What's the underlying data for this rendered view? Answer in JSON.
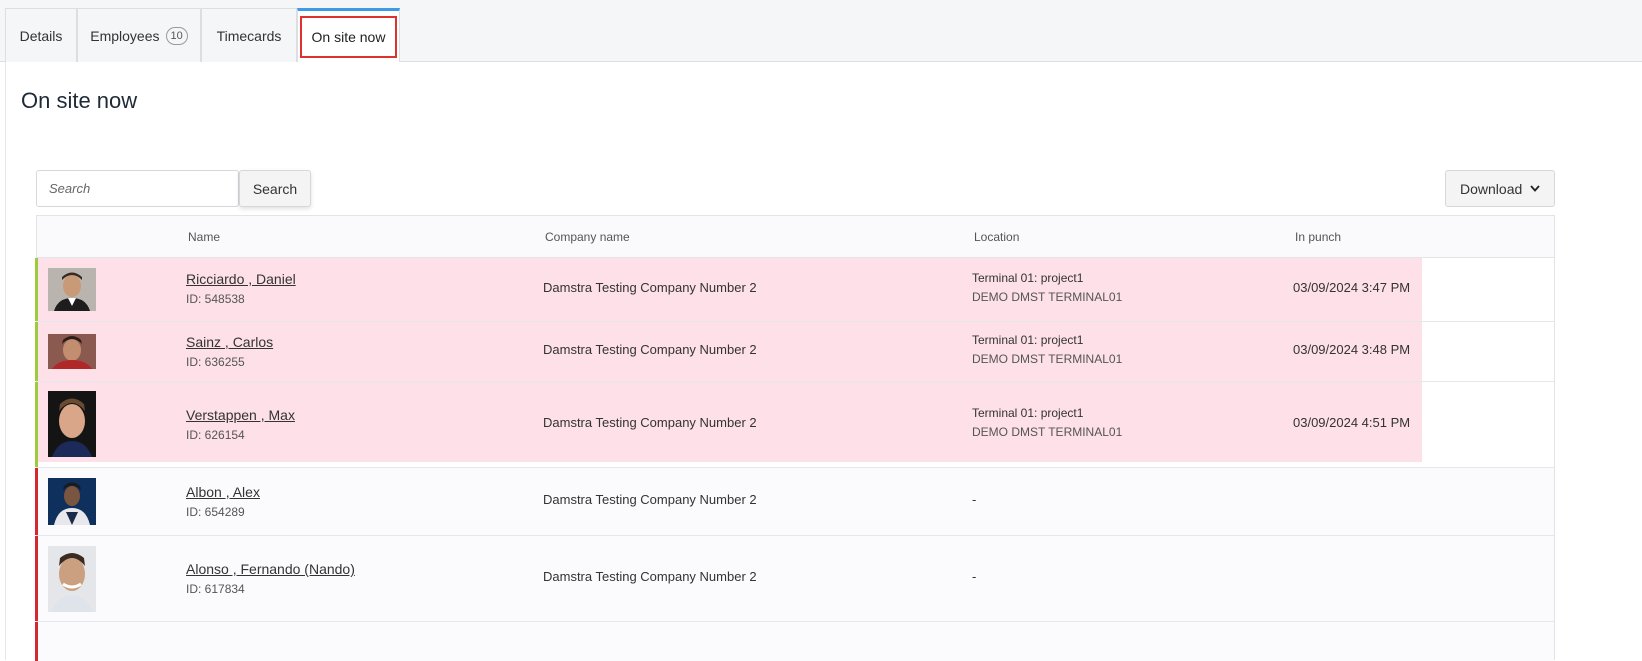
{
  "tabs": [
    {
      "label": "Details"
    },
    {
      "label": "Employees",
      "badge": "10"
    },
    {
      "label": "Timecards"
    },
    {
      "label": "On site now",
      "active": true
    }
  ],
  "page": {
    "title": "On site now"
  },
  "search": {
    "placeholder": "Search",
    "button_label": "Search"
  },
  "download": {
    "label": "Download"
  },
  "table": {
    "columns": [
      "Name",
      "Company name",
      "Location",
      "In punch"
    ],
    "rows": [
      {
        "name": "Ricciardo , Daniel",
        "id": "ID: 548538",
        "company": "Damstra Testing Company Number 2",
        "location1": "Terminal 01: project1",
        "location2": "DEMO DMST TERMINAL01",
        "in_punch": "03/09/2024 3:47 PM",
        "status": "onsite"
      },
      {
        "name": "Sainz , Carlos",
        "id": "ID: 636255",
        "company": "Damstra Testing Company Number 2",
        "location1": "Terminal 01: project1",
        "location2": "DEMO DMST TERMINAL01",
        "in_punch": "03/09/2024 3:48 PM",
        "status": "onsite"
      },
      {
        "name": "Verstappen , Max",
        "id": "ID: 626154",
        "company": "Damstra Testing Company Number 2",
        "location1": "Terminal 01: project1",
        "location2": "DEMO DMST TERMINAL01",
        "in_punch": "03/09/2024 4:51 PM",
        "status": "onsite"
      },
      {
        "name": "Albon , Alex",
        "id": "ID: 654289",
        "company": "Damstra Testing Company Number 2",
        "location1": "-",
        "location2": "",
        "in_punch": "",
        "status": "offsite"
      },
      {
        "name": "Alonso , Fernando (Nando)",
        "id": "ID: 617834",
        "company": "Damstra Testing Company Number 2",
        "location1": "-",
        "location2": "",
        "in_punch": "",
        "status": "offsite"
      }
    ]
  },
  "colors": {
    "accent": "#3d9ae8",
    "onsite_bar": "#9ccc3c",
    "offsite_bar": "#d6262e",
    "highlight": "#fde0e8",
    "tab_outline": "#e03131"
  }
}
